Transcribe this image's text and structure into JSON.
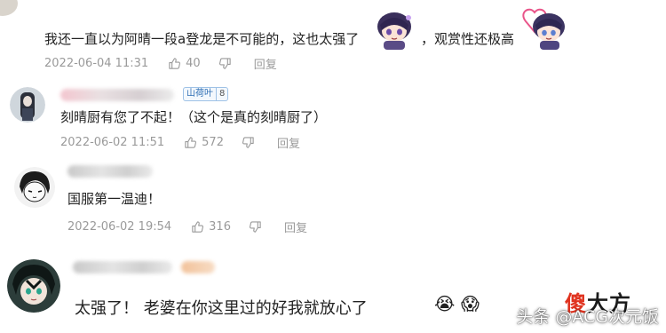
{
  "comments": [
    {
      "text_before": "我还一直以为阿晴一段a登龙是不可能的，这也太强了",
      "text_after": "，观赏性还极高",
      "date": "2022-06-04 11:31",
      "likes": "40",
      "reply_label": "回复"
    },
    {
      "badge_label": "山荷叶",
      "badge_level": "8",
      "text": "刻晴厨有您了不起！（这个是真的刻晴厨了）",
      "date": "2022-06-02 11:51",
      "likes": "572",
      "reply_label": "回复"
    },
    {
      "text": "国服第一温迪！",
      "date": "2022-06-02 19:54",
      "likes": "316",
      "reply_label": "回复"
    },
    {
      "text": "太强了！ 老婆在你这里过的好我就放心了"
    }
  ],
  "watermark": "头条 @ACG次元饭",
  "logo": {
    "char1": "傻",
    "chars_rest": "大方",
    "color1": "#e0331f",
    "color_rest": "#1a1a1a"
  },
  "icons": [
    "like-icon",
    "dislike-icon",
    "avatar",
    "sticker",
    "emoji-crying",
    "emoji-scream"
  ]
}
